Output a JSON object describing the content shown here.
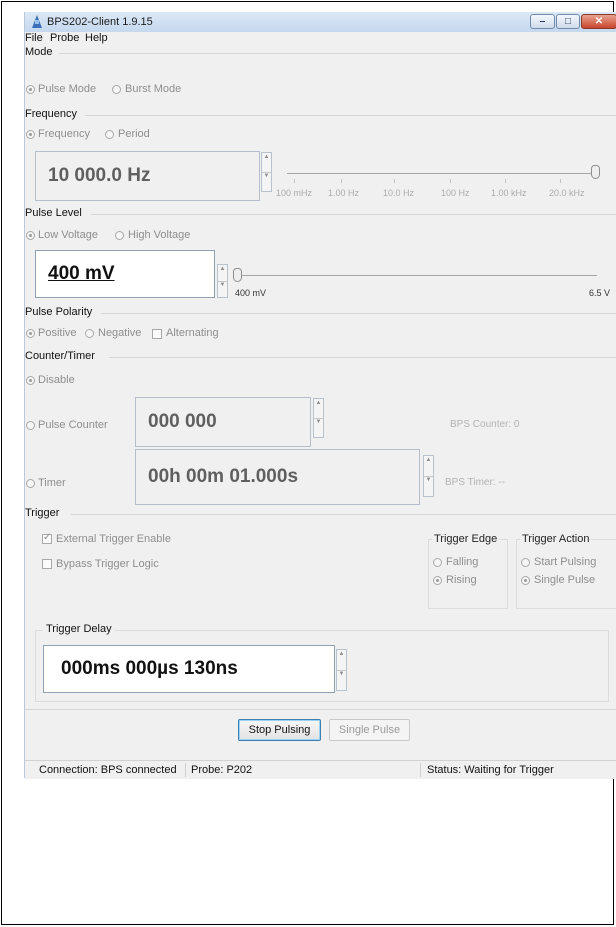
{
  "window": {
    "title": "BPS202-Client 1.9.15",
    "min_glyph": "–",
    "max_glyph": "□",
    "close_glyph": "✕"
  },
  "menu": [
    "File",
    "Probe",
    "Help"
  ],
  "mode": {
    "title": "Mode",
    "pulse_mode": "Pulse Mode",
    "burst_mode": "Burst Mode",
    "selected": "Pulse Mode"
  },
  "frequency": {
    "title": "Frequency",
    "opt_frequency": "Frequency",
    "opt_period": "Period",
    "selected": "Frequency",
    "value": "10 000.0 Hz",
    "slider_labels": [
      "100 mHz",
      "1.00 Hz",
      "10.0 Hz",
      "100 Hz",
      "1.00 kHz",
      "20.0 kHz"
    ],
    "slider_level_fraction": 1.0
  },
  "pulse_level": {
    "title": "Pulse Level",
    "opt_low": "Low Voltage",
    "opt_high": "High Voltage",
    "selected": "Low Voltage",
    "value": "400 mV",
    "min_label": "400 mV",
    "max_label": "6.5 V",
    "slider_level_fraction": 0.0
  },
  "polarity": {
    "title": "Pulse Polarity",
    "positive": "Positive",
    "negative": "Negative",
    "alternating": "Alternating",
    "selected": "Positive"
  },
  "counter": {
    "title": "Counter/Timer",
    "disable": "Disable",
    "pulse_counter": "Pulse Counter",
    "counter_value": "000 000",
    "counter_status": "BPS Counter: 0",
    "timer": "Timer",
    "timer_value": "00h 00m 01.000s",
    "timer_status": "BPS Timer: --"
  },
  "trigger": {
    "title": "Trigger",
    "external_enable": "External Trigger Enable",
    "bypass_logic": "Bypass Trigger Logic",
    "edge_title": "Trigger Edge",
    "falling": "Falling",
    "rising": "Rising",
    "action_title": "Trigger Action",
    "start_pulsing": "Start Pulsing",
    "single_pulse": "Single Pulse",
    "delay_title": "Trigger Delay",
    "delay_value": "000ms 000µs 130ns"
  },
  "buttons": {
    "stop": "Stop Pulsing",
    "single": "Single Pulse"
  },
  "status": {
    "connection": "Connection: BPS connected",
    "probe": "Probe: P202",
    "state": "Status: Waiting for Trigger"
  }
}
